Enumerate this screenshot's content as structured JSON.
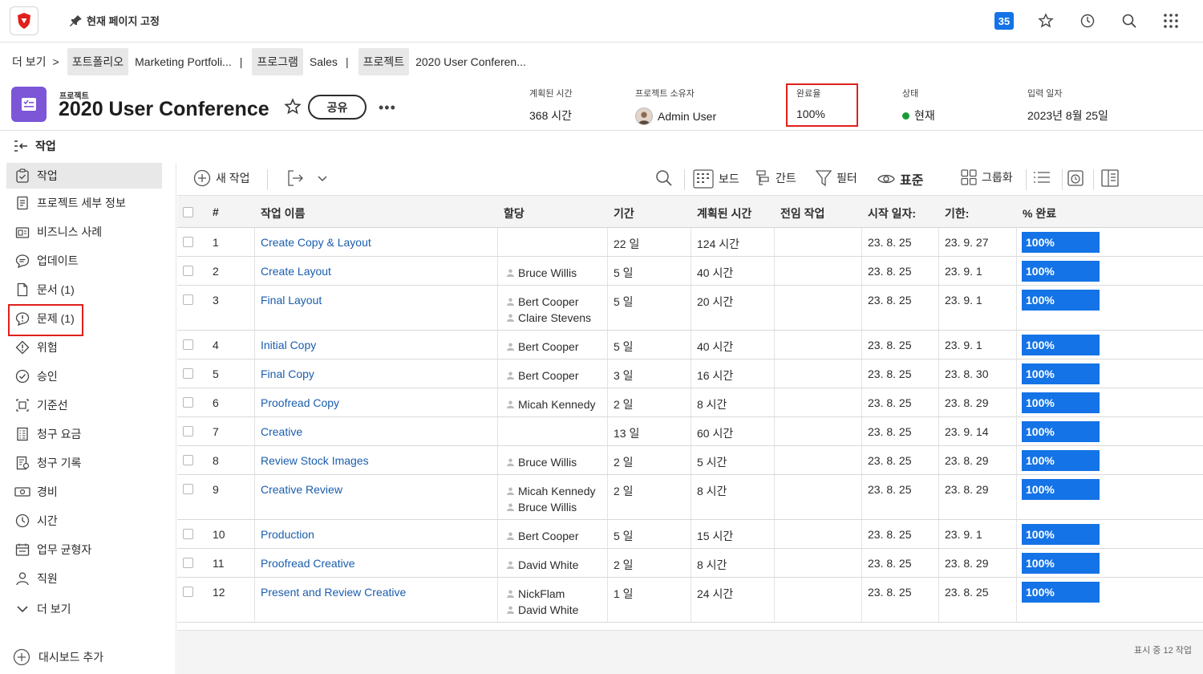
{
  "topbar": {
    "pin_label": "현재 페이지 고정",
    "notifications": "35",
    "icons": [
      "star-icon",
      "history-icon",
      "search-icon",
      "apps-grid-icon"
    ]
  },
  "breadcrumb": {
    "more": "더 보기",
    "chevron": ">",
    "sep": "|",
    "items": [
      {
        "tag": "포트폴리오",
        "value": "Marketing Portfoli..."
      },
      {
        "tag": "프로그램",
        "value": "Sales"
      },
      {
        "tag": "프로젝트",
        "value": "2020 User Conferen..."
      }
    ]
  },
  "project": {
    "kind": "프로젝트",
    "title": "2020 User Conference",
    "share_label": "공유",
    "more_label": "•••",
    "accent": "#7c56d6"
  },
  "meta": [
    {
      "label": "계획된 시간",
      "value": "368 시간"
    },
    {
      "label": "프로젝트 소유자",
      "value": "Admin User"
    },
    {
      "label": "완료율",
      "value": "100%"
    },
    {
      "label": "상태",
      "value": "현재"
    },
    {
      "label": "입력 일자",
      "value": "2023년 8월 25일"
    }
  ],
  "sidebar": {
    "title": "작업",
    "items": [
      {
        "label": "작업",
        "icon": "task-icon",
        "active": true
      },
      {
        "label": "프로젝트 세부 정보",
        "icon": "details-icon"
      },
      {
        "label": "비즈니스 사례",
        "icon": "business-case-icon"
      },
      {
        "label": "업데이트",
        "icon": "updates-icon"
      },
      {
        "label": "문서 (1)",
        "icon": "document-icon"
      },
      {
        "label": "문제 (1)",
        "icon": "issue-icon"
      },
      {
        "label": "위험",
        "icon": "risk-icon"
      },
      {
        "label": "승인",
        "icon": "approval-icon"
      },
      {
        "label": "기준선",
        "icon": "baseline-icon"
      },
      {
        "label": "청구 요금",
        "icon": "billing-rates-icon"
      },
      {
        "label": "청구 기록",
        "icon": "billing-records-icon"
      },
      {
        "label": "경비",
        "icon": "expenses-icon"
      },
      {
        "label": "시간",
        "icon": "time-icon"
      },
      {
        "label": "업무 균형자",
        "icon": "workload-balancer-icon"
      },
      {
        "label": "직원",
        "icon": "people-icon"
      },
      {
        "label": "더 보기",
        "icon": "chevron-down-icon"
      }
    ],
    "add_dashboard": "대시보드 추가"
  },
  "toolbar": {
    "new_task": "새 작업",
    "board": "보드",
    "gantt": "간트",
    "filter": "필터",
    "view": "표준",
    "group": "그룹화"
  },
  "table": {
    "headers": [
      "#",
      "작업 이름",
      "할당",
      "기간",
      "계획된 시간",
      "전임 작업",
      "시작 일자:",
      "기한:",
      "% 완료"
    ],
    "rows": [
      {
        "num": "1",
        "name": "Create Copy & Layout",
        "assignees": [],
        "duration": "22 일",
        "planned": "124 시간",
        "pred": "",
        "start": "23. 8. 25",
        "due": "23. 9. 27",
        "pct": "100%"
      },
      {
        "num": "2",
        "name": "Create Layout",
        "assignees": [
          "Bruce Willis"
        ],
        "duration": "5 일",
        "planned": "40 시간",
        "pred": "",
        "start": "23. 8. 25",
        "due": "23. 9. 1",
        "pct": "100%"
      },
      {
        "num": "3",
        "name": "Final Layout",
        "assignees": [
          "Bert Cooper",
          "Claire Stevens"
        ],
        "duration": "5 일",
        "planned": "20 시간",
        "pred": "",
        "start": "23. 8. 25",
        "due": "23. 9. 1",
        "pct": "100%"
      },
      {
        "num": "4",
        "name": "Initial Copy",
        "assignees": [
          "Bert Cooper"
        ],
        "duration": "5 일",
        "planned": "40 시간",
        "pred": "",
        "start": "23. 8. 25",
        "due": "23. 9. 1",
        "pct": "100%"
      },
      {
        "num": "5",
        "name": "Final Copy",
        "assignees": [
          "Bert Cooper"
        ],
        "duration": "3 일",
        "planned": "16 시간",
        "pred": "",
        "start": "23. 8. 25",
        "due": "23. 8. 30",
        "pct": "100%"
      },
      {
        "num": "6",
        "name": "Proofread Copy",
        "assignees": [
          "Micah Kennedy"
        ],
        "duration": "2 일",
        "planned": "8 시간",
        "pred": "",
        "start": "23. 8. 25",
        "due": "23. 8. 29",
        "pct": "100%"
      },
      {
        "num": "7",
        "name": "Creative",
        "assignees": [],
        "duration": "13 일",
        "planned": "60 시간",
        "pred": "",
        "start": "23. 8. 25",
        "due": "23. 9. 14",
        "pct": "100%"
      },
      {
        "num": "8",
        "name": "Review Stock Images",
        "assignees": [
          "Bruce Willis"
        ],
        "duration": "2 일",
        "planned": "5 시간",
        "pred": "",
        "start": "23. 8. 25",
        "due": "23. 8. 29",
        "pct": "100%"
      },
      {
        "num": "9",
        "name": "Creative Review",
        "assignees": [
          "Micah Kennedy",
          "Bruce Willis"
        ],
        "duration": "2 일",
        "planned": "8 시간",
        "pred": "",
        "start": "23. 8. 25",
        "due": "23. 8. 29",
        "pct": "100%"
      },
      {
        "num": "10",
        "name": "Production",
        "assignees": [
          "Bert Cooper"
        ],
        "duration": "5 일",
        "planned": "15 시간",
        "pred": "",
        "start": "23. 8. 25",
        "due": "23. 9. 1",
        "pct": "100%"
      },
      {
        "num": "11",
        "name": "Proofread Creative",
        "assignees": [
          "David White"
        ],
        "duration": "2 일",
        "planned": "8 시간",
        "pred": "",
        "start": "23. 8. 25",
        "due": "23. 8. 29",
        "pct": "100%"
      },
      {
        "num": "12",
        "name": "Present and Review Creative",
        "assignees": [
          "NickFlam",
          "David White"
        ],
        "duration": "1 일",
        "planned": "24 시간",
        "pred": "",
        "start": "23. 8. 25",
        "due": "23. 8. 25",
        "pct": "100%"
      }
    ],
    "footer": "표시 중 12 작업",
    "pct_color": "#1473e6"
  }
}
